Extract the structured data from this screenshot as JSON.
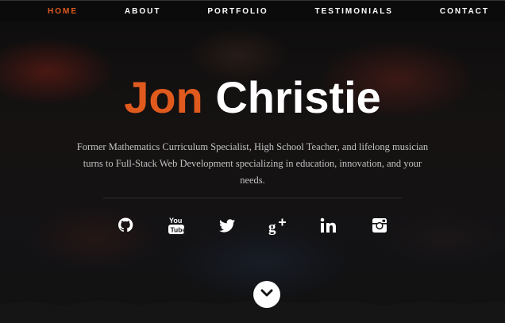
{
  "nav": {
    "items": [
      {
        "label": "HOME",
        "active": true
      },
      {
        "label": "ABOUT",
        "active": false
      },
      {
        "label": "PORTFOLIO",
        "active": false
      },
      {
        "label": "TESTIMONIALS",
        "active": false
      },
      {
        "label": "CONTACT",
        "active": false
      }
    ]
  },
  "hero": {
    "first_name": "Jon",
    "last_name": "Christie",
    "tagline": "Former Mathematics Curriculum Specialist, High School Teacher, and lifelong musician turns to Full-Stack Web Development specializing in education, innovation, and your needs."
  },
  "social": {
    "icons": [
      "github-icon",
      "youtube-icon",
      "twitter-icon",
      "google-plus-icon",
      "linkedin-icon",
      "instagram-icon"
    ]
  },
  "scroll": {
    "icon": "chevron-down-icon"
  },
  "colors": {
    "accent": "#e05a1e",
    "nav_background": "#0b0b0b",
    "title_text": "#ffffff",
    "tagline_text": "#c2c2c2"
  }
}
